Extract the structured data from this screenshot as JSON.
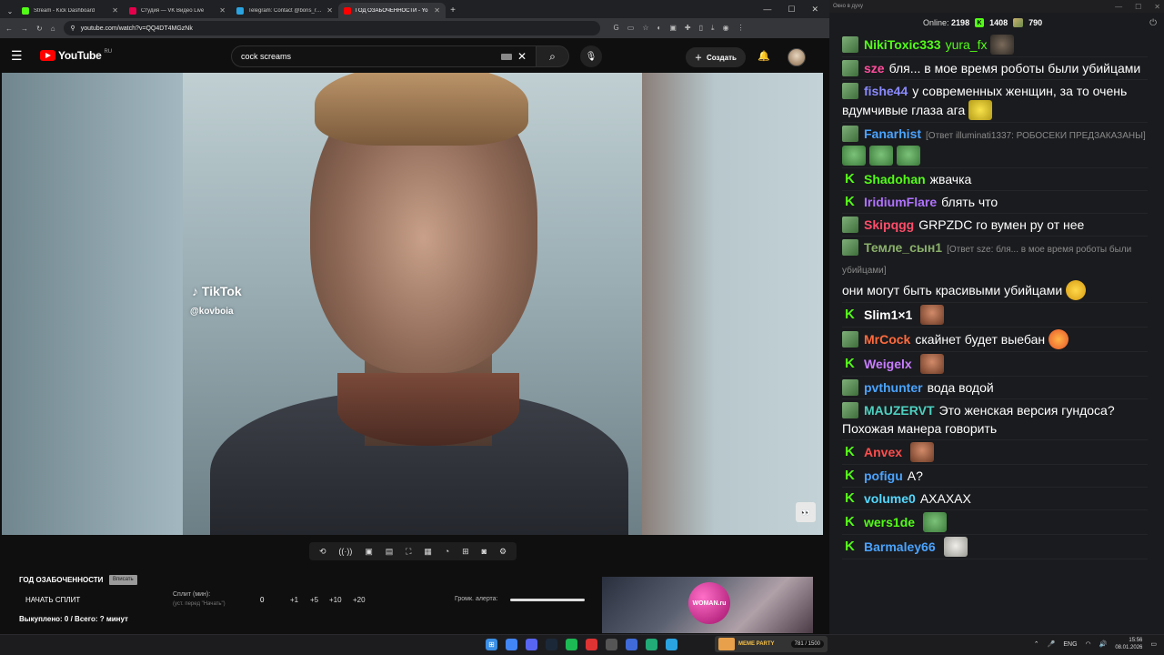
{
  "browser": {
    "tabs": [
      {
        "title": "Stream - Kick Dashboard",
        "fav": "#53fc18",
        "active": false
      },
      {
        "title": "Студия — VK Видео Live",
        "fav": "#e6004c",
        "active": false
      },
      {
        "title": "Telegram: Contact @boris_roch",
        "fav": "#2aa3e0",
        "active": false
      },
      {
        "title": "ГОД ОЗАБОЧЕННОСТИ - Yo",
        "fav": "#ff0000",
        "active": true
      }
    ],
    "url": "youtube.com/watch?v=QQ4DT4MGzNk"
  },
  "youtube": {
    "logo_text": "YouTube",
    "region": "RU",
    "search_value": "cock screams",
    "create_label": "Создать"
  },
  "video": {
    "watermark": "TikTok",
    "watermark_user": "@kovboia"
  },
  "panel": {
    "title": "ГОД ОЗАБОЧЕННОСТИ",
    "badge": "Вписать",
    "start_label": "НАЧАТЬ СПЛИТ",
    "split_label": "Сплит (мин):",
    "split_hint": "(уст. перед \"Начать\")",
    "split_value": "0",
    "increments": [
      "+1",
      "+5",
      "+10",
      "+20"
    ],
    "volume_label": "Громк. алерта:",
    "volume_level": 1.0,
    "stats": "Выкуплено: 0 / Всего: ? минут",
    "ad_text": "WOMAN.ru"
  },
  "chat": {
    "window_title": "Окно в духу",
    "online_label": "Online:",
    "online_value": "2198",
    "kick_count": "1408",
    "other_count": "790",
    "messages": [
      {
        "badge": "sub",
        "nick": "NikiToxic333",
        "color": "#53fc18",
        "text": "yura_fx",
        "text_color": "#53fc18",
        "emote": "e-dark"
      },
      {
        "badge": "sub",
        "nick": "sze",
        "color": "#ff4d9d",
        "text": "бля... в мое время роботы были убийцами"
      },
      {
        "badge": "sub",
        "nick": "fishe44",
        "color": "#8a8aff",
        "text": "у современных женщин, за то очень вдумчивые глаза ага",
        "emote": "e-spongebob"
      },
      {
        "badge": "sub",
        "nick": "Fanarhist",
        "color": "#4aa3ff",
        "reply": "[Ответ illuminati1337: РОБОСЕКИ ПРЕДЗАКАЗАНЫ]",
        "text": "",
        "emote3": "e-pepe"
      },
      {
        "badge": "kick",
        "nick": "Shadohan",
        "color": "#53fc18",
        "text": "жвачка"
      },
      {
        "badge": "kick",
        "nick": "IridiumFlare",
        "color": "#b073ff",
        "text": "блять что"
      },
      {
        "badge": "sub",
        "nick": "Skipqgg",
        "color": "#ff4d6a",
        "text": "GRPZDC го вумен ру от нее",
        "nick2": "GRPZDC"
      },
      {
        "badge": "sub",
        "nick": "Темле_сын1",
        "color": "#8ab06a",
        "reply": "[Ответ sze: бля... в мое время роботы были убийцами]",
        "text": "они могут быть красивыми убийцами",
        "emote": "e-smile"
      },
      {
        "badge": "kick",
        "nick": "Slim1×1",
        "color": "#ffffff",
        "text": "",
        "emote": "e-face"
      },
      {
        "badge": "sub",
        "nick": "MrCock",
        "color": "#ff6b3d",
        "text": "скайнет будет выебан",
        "emote": "e-love"
      },
      {
        "badge": "kick",
        "nick": "Weigelx",
        "color": "#c77dff",
        "text": "",
        "emote": "e-face"
      },
      {
        "badge": "sub",
        "nick": "pvthunter",
        "color": "#4aa3ff",
        "text": "вода водой"
      },
      {
        "badge": "sub",
        "nick": "MAUZERVT",
        "color": "#4dd0c0",
        "text": "Это женская версия гундоса? Похожая манера говорить"
      },
      {
        "badge": "kick",
        "nick": "Anvex",
        "color": "#ff4d4d",
        "text": "",
        "emote": "e-face"
      },
      {
        "badge": "kick",
        "nick": "pofigu",
        "color": "#4aa3ff",
        "text": "А?"
      },
      {
        "badge": "kick",
        "nick": "volume0",
        "color": "#53d8ff",
        "text": "АХАХАХ"
      },
      {
        "badge": "kick",
        "nick": "wers1de",
        "color": "#53fc18",
        "text": "",
        "emote": "e-pepe"
      },
      {
        "badge": "kick",
        "nick": "Barmaley66",
        "color": "#4aa3ff",
        "text": "",
        "emote": "e-cat"
      }
    ]
  },
  "taskbar": {
    "meme_label": "MEME PARTY",
    "meme_count": "781 / 1500",
    "lang": "ENG",
    "time": "15:56",
    "date": "08.01.2026"
  }
}
